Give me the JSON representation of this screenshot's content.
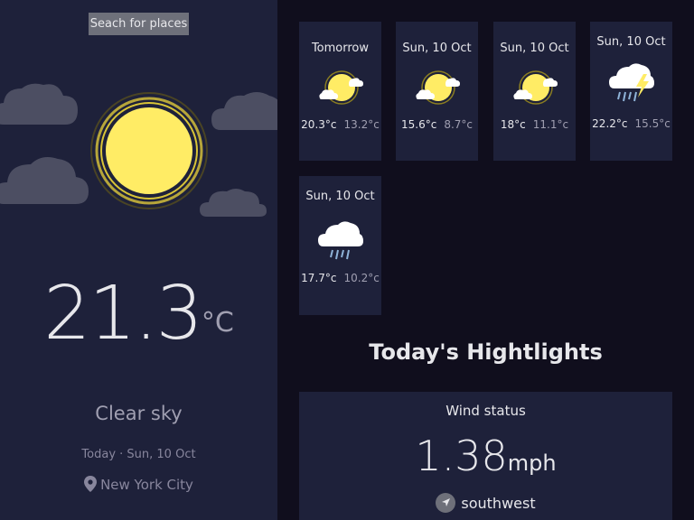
{
  "sidebar": {
    "search_label": "Seach for places",
    "temperature": "21.3",
    "unit": "°C",
    "condition": "Clear sky",
    "date_line": "Today · Sun, 10 Oct",
    "location": "New York City"
  },
  "forecast": [
    {
      "day": "Tomorrow",
      "icon": "sun-cloud-icon",
      "max": "20.3°c",
      "min": "13.2°c"
    },
    {
      "day": "Sun, 10 Oct",
      "icon": "sun-cloud-icon",
      "max": "15.6°c",
      "min": "8.7°c"
    },
    {
      "day": "Sun, 10 Oct",
      "icon": "sun-cloud-icon",
      "max": "18°c",
      "min": "11.1°c"
    },
    {
      "day": "Sun, 10 Oct",
      "icon": "thunderstorm-icon",
      "max": "22.2°c",
      "min": "15.5°c"
    },
    {
      "day": "Sun, 10 Oct",
      "icon": "rain-cloud-icon",
      "max": "17.7°c",
      "min": "10.2°c"
    }
  ],
  "highlights": {
    "title": "Today's Hightlights",
    "wind": {
      "label": "Wind status",
      "value": "1.38",
      "unit": "mph",
      "direction": "southwest"
    }
  },
  "colors": {
    "sidebar_bg": "#1e213a",
    "page_bg": "#100e1d",
    "sun": "#ffec65"
  }
}
